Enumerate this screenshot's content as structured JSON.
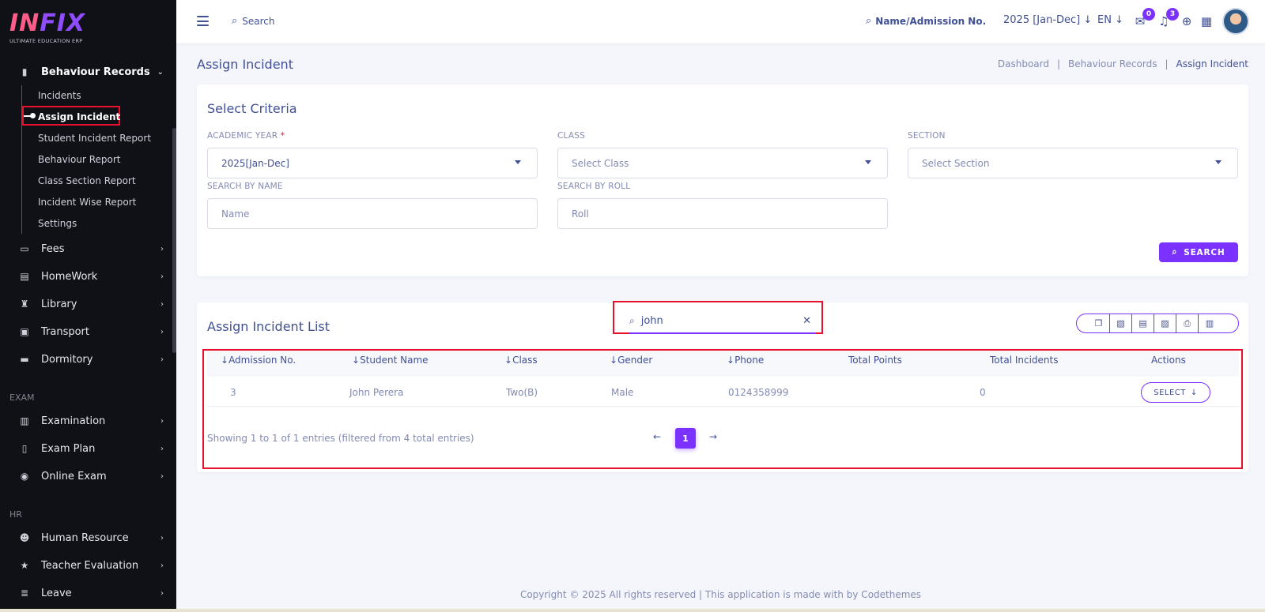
{
  "brand": {
    "name_part1": "IN",
    "name_part2": "FIX",
    "tagline": "ULTIMATE EDUCATION ERP"
  },
  "sidebar": {
    "behaviour": {
      "label": "Behaviour Records",
      "subitems": [
        "Incidents",
        "Assign Incident",
        "Student Incident Report",
        "Behaviour Report",
        "Class Section Report",
        "Incident Wise Report",
        "Settings"
      ]
    },
    "menu_top": [
      "Fees",
      "HomeWork",
      "Library",
      "Transport",
      "Dormitory"
    ],
    "section_exam": "EXAM",
    "menu_exam": [
      "Examination",
      "Exam Plan",
      "Online Exam"
    ],
    "section_hr": "HR",
    "menu_hr": [
      "Human Resource",
      "Teacher Evaluation",
      "Leave"
    ]
  },
  "topbar": {
    "search_label": "Search",
    "admission_search": "Name/Admission No.",
    "year": "2025 [Jan-Dec]",
    "lang": "EN",
    "messages_count": "0",
    "notifications_count": "3"
  },
  "page": {
    "title": "Assign Incident",
    "breadcrumb": [
      "Dashboard",
      "Behaviour Records",
      "Assign Incident"
    ]
  },
  "criteria": {
    "title": "Select Criteria",
    "academic_year_label": "ACADEMIC YEAR",
    "academic_year_value": "2025[Jan-Dec]",
    "class_label": "CLASS",
    "class_placeholder": "Select Class",
    "section_label": "SECTION",
    "section_placeholder": "Select Section",
    "name_label": "SEARCH BY NAME",
    "name_placeholder": "Name",
    "roll_label": "SEARCH BY ROLL",
    "roll_placeholder": "Roll",
    "search_button": "SEARCH"
  },
  "list": {
    "title": "Assign Incident List",
    "search_value": "john",
    "columns": [
      "Admission No.",
      "Student Name",
      "Class",
      "Gender",
      "Phone",
      "Total Points",
      "Total Incidents",
      "Actions"
    ],
    "rows": [
      {
        "admission": "3",
        "name": "John Perera",
        "class": "Two(B)",
        "gender": "Male",
        "phone": "0124358999",
        "points": "",
        "incidents": "0",
        "action": "SELECT"
      }
    ],
    "info": "Showing 1 to 1 of 1 entries (filtered from 4 total entries)",
    "page": "1"
  },
  "footer": "Copyright © 2025 All rights reserved | This application is made with by Codethemes",
  "colors": {
    "accent": "#7c32ff",
    "text": "#415094",
    "muted": "#828bb2",
    "highlight": "#e8112d"
  }
}
